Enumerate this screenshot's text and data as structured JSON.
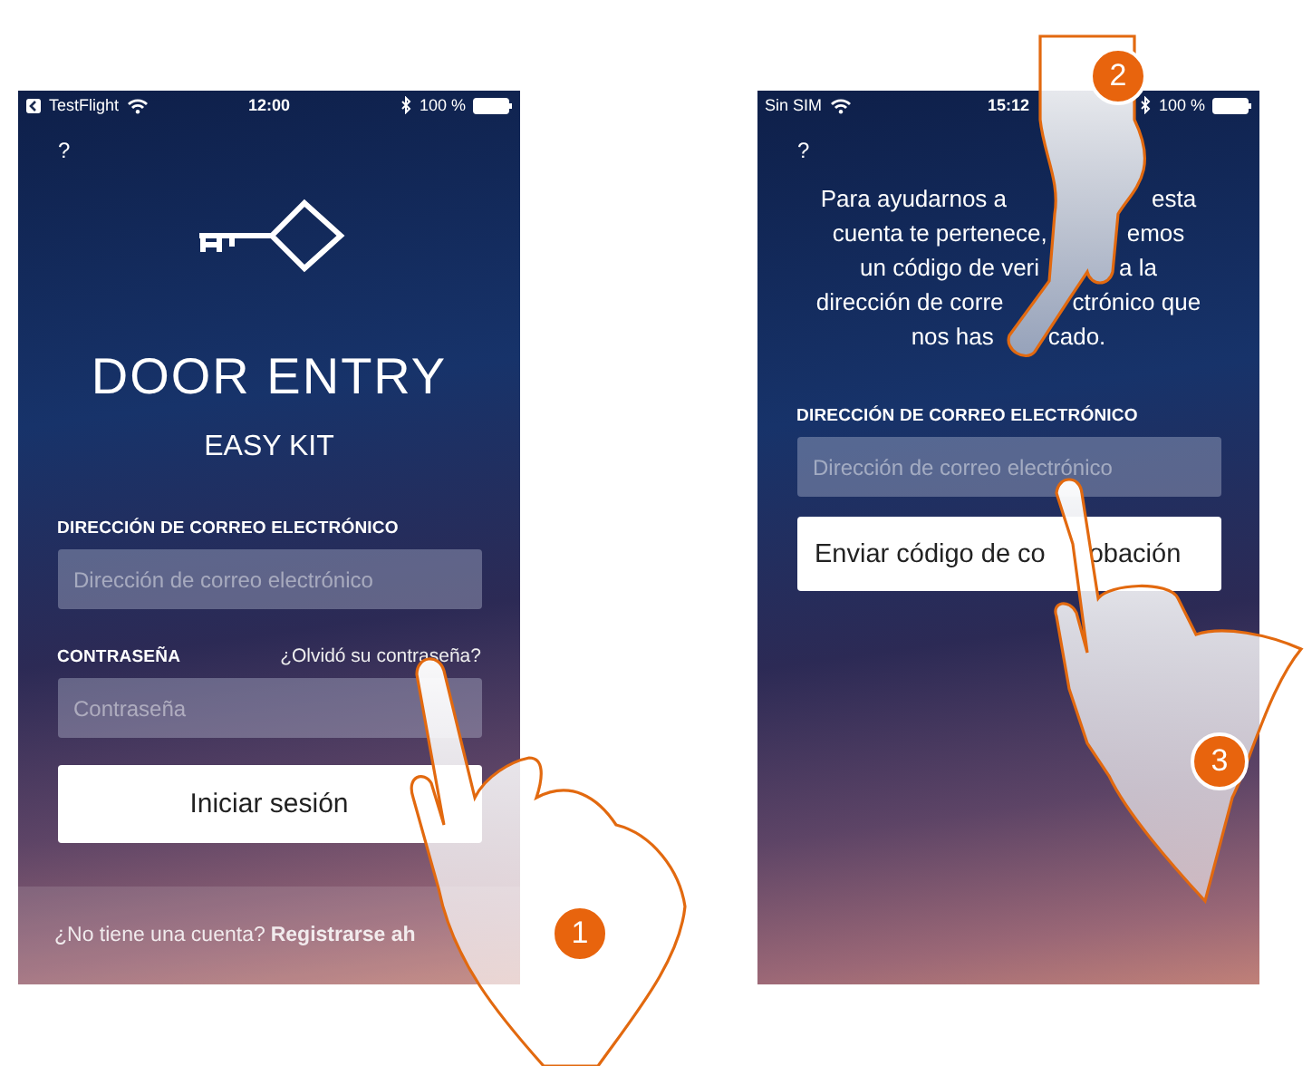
{
  "screens": [
    {
      "kind": "login",
      "status_bar": {
        "back_to_app": true,
        "carrier": "TestFlight",
        "time": "12:00",
        "battery": "100 %"
      },
      "help": "?",
      "title": "DOOR ENTRY",
      "subtitle": "EASY KIT",
      "email_label": "DIRECCIÓN DE CORREO ELECTRÓNICO",
      "email_placeholder": "Dirección de correo electrónico",
      "password_label": "CONTRASEÑA",
      "forgot_link": "¿Olvidó su contraseña?",
      "password_placeholder": "Contraseña",
      "login_button": "Iniciar sesión",
      "footer_text": "¿No tiene una cuenta?",
      "footer_link": "Registrarse ah"
    },
    {
      "kind": "verify",
      "status_bar": {
        "carrier": "Sin SIM",
        "time": "15:12",
        "battery": "100 %"
      },
      "help": "?",
      "message_lines": [
        [
          "Para ayudarnos a",
          "esta"
        ],
        [
          "cuenta te pertenece,",
          "emos"
        ],
        [
          "un código de veri",
          "a la"
        ],
        [
          "dirección de corre",
          "ctrónico que"
        ],
        [
          "nos has",
          "cado."
        ]
      ],
      "email_label": "DIRECCIÓN DE CORREO ELECTRÓNICO",
      "email_placeholder": "Dirección de correo electrónico",
      "send_button": [
        "Enviar código de co",
        "obación"
      ]
    }
  ],
  "step_badges": [
    "1",
    "2",
    "3"
  ]
}
